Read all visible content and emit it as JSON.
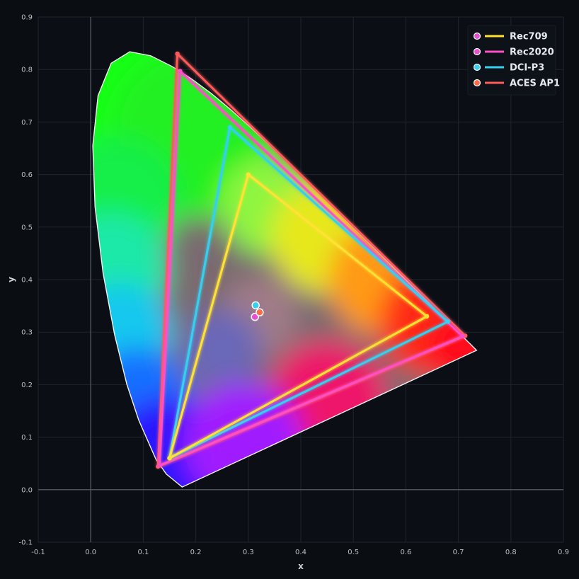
{
  "chart_data": {
    "type": "scatter",
    "title": "",
    "xlabel": "x",
    "ylabel": "y",
    "xlim": [
      -0.1,
      0.9
    ],
    "ylim": [
      -0.1,
      0.9
    ],
    "grid": true,
    "x_ticks": [
      "-0.1",
      "0.0",
      "0.1",
      "0.2",
      "0.3",
      "0.4",
      "0.5",
      "0.6",
      "0.7",
      "0.8",
      "0.9"
    ],
    "y_ticks": [
      "-0.1",
      "0.0",
      "0.1",
      "0.2",
      "0.3",
      "0.4",
      "0.5",
      "0.6",
      "0.7",
      "0.8",
      "0.9"
    ],
    "legend_position": "top-right",
    "spectral_locus": [
      [
        0.1741,
        0.005
      ],
      [
        0.144,
        0.0297
      ],
      [
        0.1241,
        0.0578
      ],
      [
        0.0913,
        0.1327
      ],
      [
        0.0687,
        0.2007
      ],
      [
        0.0454,
        0.295
      ],
      [
        0.0235,
        0.4127
      ],
      [
        0.0082,
        0.5384
      ],
      [
        0.0039,
        0.6548
      ],
      [
        0.0139,
        0.7502
      ],
      [
        0.0389,
        0.812
      ],
      [
        0.0743,
        0.8338
      ],
      [
        0.1142,
        0.8262
      ],
      [
        0.1547,
        0.8059
      ],
      [
        0.1929,
        0.7816
      ],
      [
        0.2296,
        0.7543
      ],
      [
        0.2658,
        0.7243
      ],
      [
        0.3016,
        0.6923
      ],
      [
        0.3373,
        0.6589
      ],
      [
        0.3731,
        0.6245
      ],
      [
        0.4087,
        0.5896
      ],
      [
        0.4441,
        0.5547
      ],
      [
        0.4788,
        0.5202
      ],
      [
        0.5125,
        0.4866
      ],
      [
        0.5448,
        0.4544
      ],
      [
        0.5752,
        0.4242
      ],
      [
        0.6029,
        0.3965
      ],
      [
        0.627,
        0.3725
      ],
      [
        0.6482,
        0.3514
      ],
      [
        0.6658,
        0.334
      ],
      [
        0.6801,
        0.3197
      ],
      [
        0.6915,
        0.3083
      ],
      [
        0.7006,
        0.2993
      ],
      [
        0.7079,
        0.292
      ],
      [
        0.714,
        0.2859
      ],
      [
        0.719,
        0.2809
      ],
      [
        0.723,
        0.277
      ],
      [
        0.726,
        0.274
      ],
      [
        0.7283,
        0.2717
      ],
      [
        0.73,
        0.27
      ],
      [
        0.7347,
        0.2653
      ]
    ],
    "series": [
      {
        "name": "Rec709",
        "color": "#ffe234",
        "primaries": [
          [
            0.64,
            0.33
          ],
          [
            0.3,
            0.6
          ],
          [
            0.15,
            0.06
          ]
        ],
        "white_point": [
          0.3127,
          0.329
        ],
        "white_point_color": "#e84fd0"
      },
      {
        "name": "Rec2020",
        "color": "#ff4fc8",
        "primaries": [
          [
            0.708,
            0.292
          ],
          [
            0.17,
            0.797
          ],
          [
            0.131,
            0.046
          ]
        ],
        "white_point": [
          0.3127,
          0.329
        ],
        "white_point_color": "#e84fd0"
      },
      {
        "name": "DCI-P3",
        "color": "#36d0f0",
        "primaries": [
          [
            0.68,
            0.32
          ],
          [
            0.265,
            0.69
          ],
          [
            0.15,
            0.06
          ]
        ],
        "white_point": [
          0.314,
          0.351
        ],
        "white_point_color": "#36d0f0"
      },
      {
        "name": "ACES AP1",
        "color": "#ff5a5a",
        "primaries": [
          [
            0.713,
            0.293
          ],
          [
            0.165,
            0.83
          ],
          [
            0.128,
            0.044
          ]
        ],
        "white_point": [
          0.32168,
          0.33767
        ],
        "white_point_color": "#ff6a4a"
      }
    ],
    "legend": [
      {
        "label": "Rec709",
        "marker_color": "#e84fd0",
        "line_color": "#ffe234"
      },
      {
        "label": "Rec2020",
        "marker_color": "#e84fd0",
        "line_color": "#ff4fc8"
      },
      {
        "label": "DCI-P3",
        "marker_color": "#36d0f0",
        "line_color": "#36d0f0"
      },
      {
        "label": "ACES AP1",
        "marker_color": "#ff6a4a",
        "line_color": "#ff5a5a"
      }
    ]
  }
}
